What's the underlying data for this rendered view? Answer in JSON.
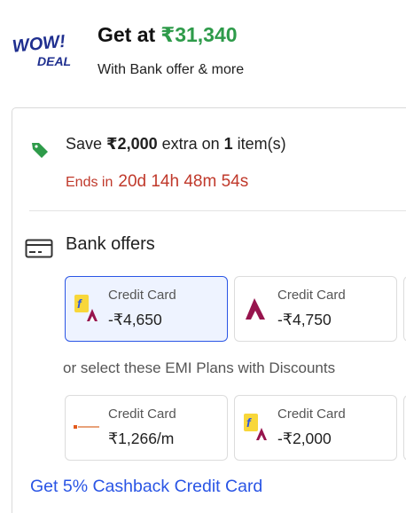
{
  "deal": {
    "logo_top": "WOW!",
    "logo_bottom": "DEAL",
    "title_prefix": "Get at",
    "title_price": "₹31,340",
    "subtitle": "With Bank offer & more"
  },
  "save_offer": {
    "prefix": "Save ",
    "amount": "₹2,000",
    "middle": " extra on ",
    "count": "1",
    "suffix": " item(s)",
    "ends_label": "Ends in",
    "timer": "20d 14h 48m 54s",
    "accent_color": "#c0392b"
  },
  "bank_offers": {
    "title": "Bank offers",
    "offers": [
      {
        "label": "Credit Card",
        "value": "-₹4,650",
        "icon": "flipkart-axis-icon",
        "selected": true
      },
      {
        "label": "Credit Card",
        "value": "-₹4,750",
        "icon": "axis-bank-icon",
        "selected": false
      }
    ]
  },
  "emi": {
    "heading": "or select these EMI Plans with Discounts",
    "plans": [
      {
        "label": "Credit Card",
        "value": "₹1,266/m",
        "icon": "bank-logo-icon"
      },
      {
        "label": "Credit Card",
        "value": "-₹2,000",
        "icon": "flipkart-axis-icon"
      }
    ]
  },
  "cashback_link": "Get 5% Cashback Credit Card",
  "colors": {
    "price_green": "#2e9b4a",
    "link_blue": "#2a55e5",
    "timer_red": "#c0392b",
    "tag_green": "#2e9b4a",
    "logo_navy": "#1f2f8f"
  }
}
